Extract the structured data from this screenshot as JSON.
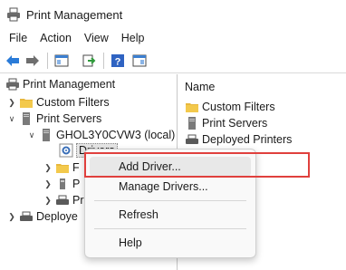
{
  "window": {
    "title": "Print Management"
  },
  "menubar": {
    "items": [
      "File",
      "Action",
      "View",
      "Help"
    ]
  },
  "toolbar": {
    "buttons": [
      "back-arrow-icon",
      "forward-arrow-icon",
      "show-hide-console-tree-icon",
      "export-list-icon",
      "help-icon",
      "show-hide-action-pane-icon"
    ]
  },
  "tree": {
    "root": "Print Management",
    "custom_filters": "Custom Filters",
    "print_servers": "Print Servers",
    "server": "GHOL3Y0CVW3 (local)",
    "drivers": "Drivers",
    "forms_partial": "F",
    "ports_partial": "P",
    "printers_partial": "Pr",
    "deployed_partial": "Deploye"
  },
  "list": {
    "header": "Name",
    "rows": [
      "Custom Filters",
      "Print Servers",
      "Deployed Printers"
    ]
  },
  "context_menu": {
    "items": [
      {
        "label": "Add Driver...",
        "highlighted": true
      },
      {
        "label": "Manage Drivers..."
      },
      {
        "label": "Refresh"
      },
      {
        "label": "Help"
      }
    ]
  },
  "colors": {
    "highlight_border": "#e0403d",
    "menu_background": "#f9f9f9",
    "hover_background": "#e8e8e8"
  }
}
